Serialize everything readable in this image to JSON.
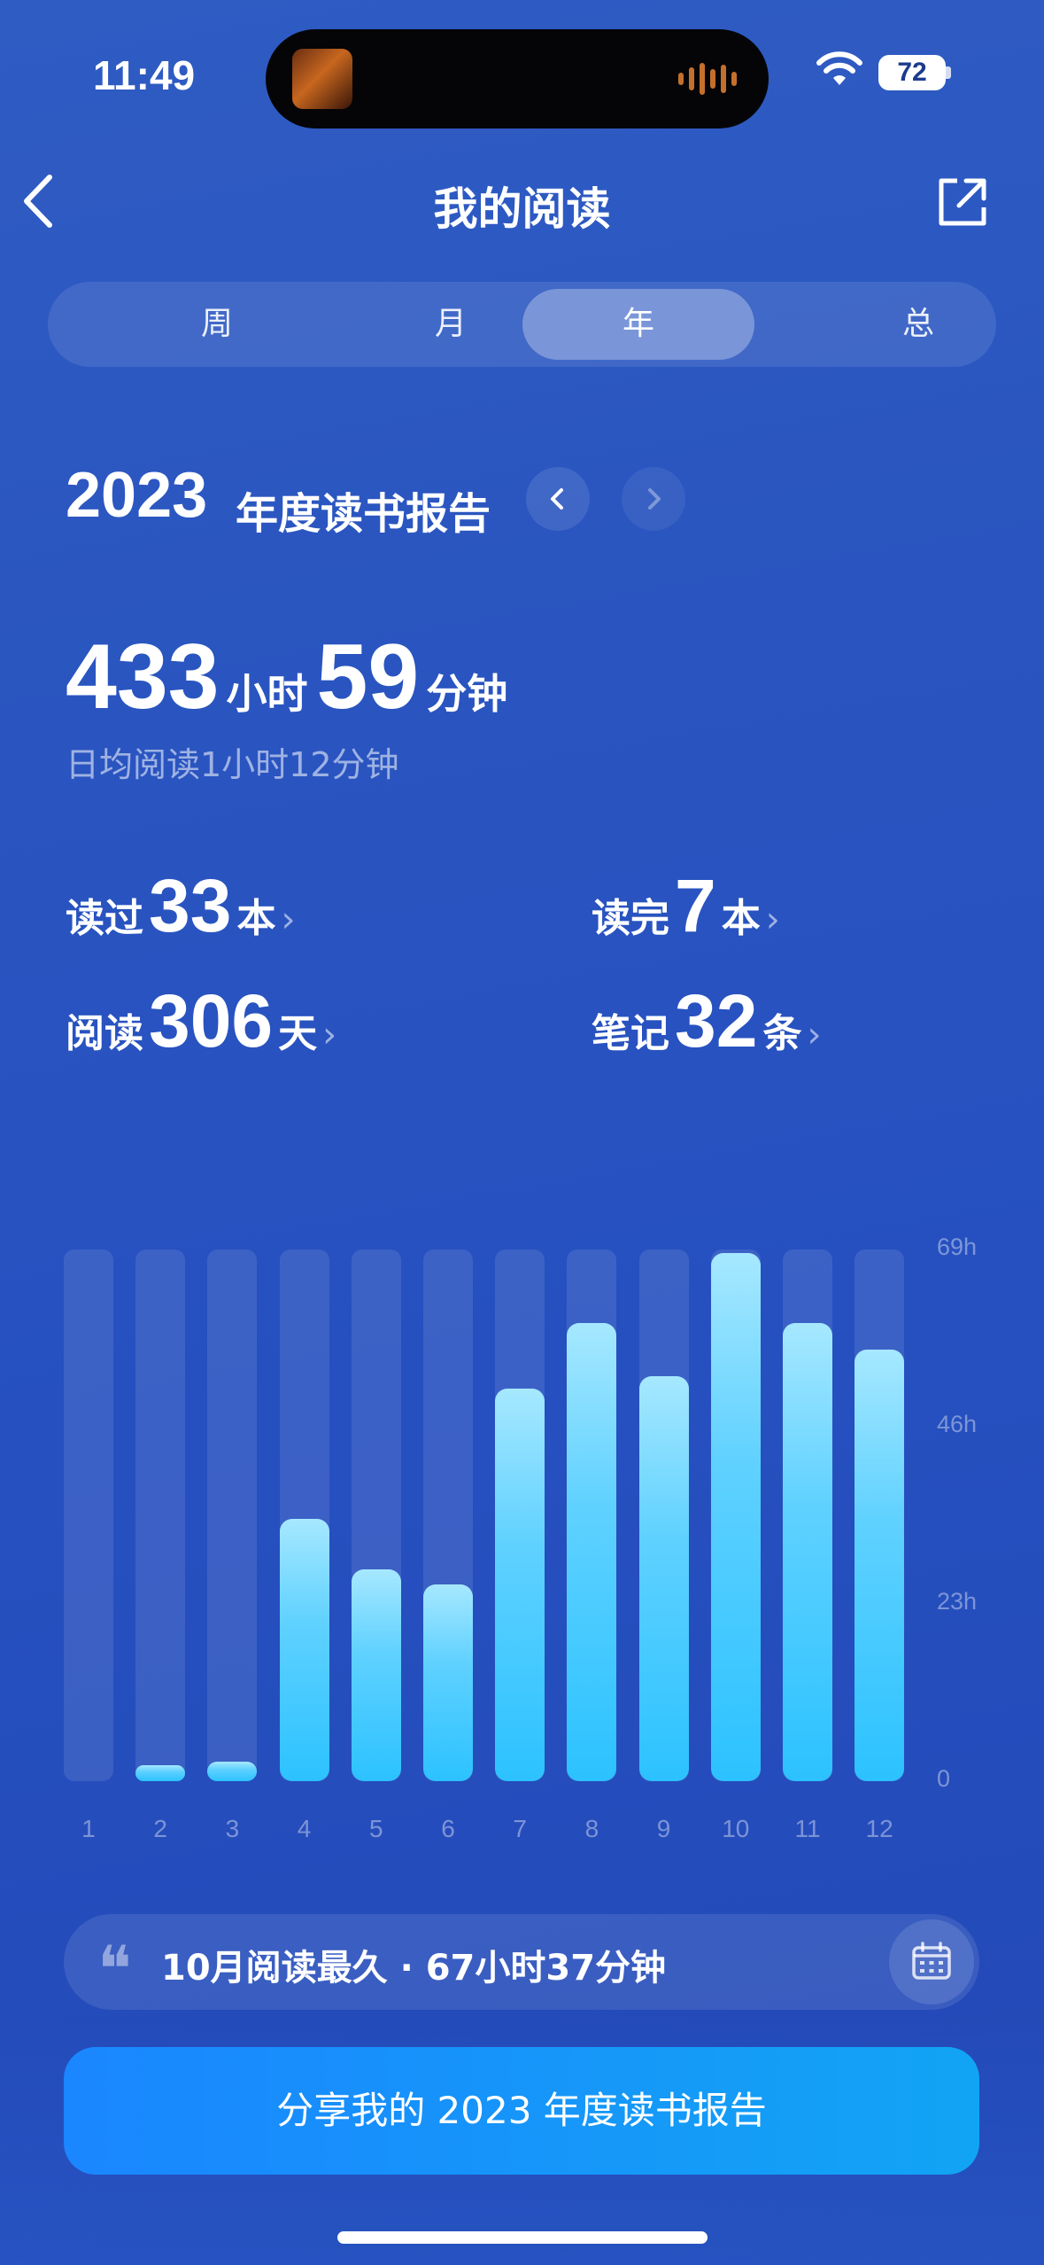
{
  "status_bar": {
    "time": "11:49",
    "battery": "72"
  },
  "nav": {
    "title": "我的阅读"
  },
  "tabs": [
    {
      "label": "周",
      "active": false
    },
    {
      "label": "月",
      "active": false
    },
    {
      "label": "年",
      "active": true
    },
    {
      "label": "总",
      "active": false
    }
  ],
  "report": {
    "year": "2023",
    "label": "年度读书报告"
  },
  "totals": {
    "hours": "433",
    "hours_unit": "小时",
    "minutes": "59",
    "minutes_unit": "分钟",
    "daily": "日均阅读1小时12分钟"
  },
  "stats": {
    "read": {
      "label": "读过",
      "value": "33",
      "unit": "本"
    },
    "finished": {
      "label": "读完",
      "value": "7",
      "unit": "本"
    },
    "days": {
      "label": "阅读",
      "value": "306",
      "unit": "天"
    },
    "notes": {
      "label": "笔记",
      "value": "32",
      "unit": "条"
    }
  },
  "chart_data": {
    "type": "bar",
    "categories": [
      "1",
      "2",
      "3",
      "4",
      "5",
      "6",
      "7",
      "8",
      "9",
      "10",
      "11",
      "12"
    ],
    "values": [
      0,
      2,
      2.5,
      34,
      27.5,
      25.5,
      51,
      59.5,
      52.5,
      68.5,
      59.5,
      56
    ],
    "y_ticks": [
      "69h",
      "46h",
      "23h",
      "0"
    ],
    "y_tick_values": [
      69,
      46,
      23,
      0
    ],
    "ylim": [
      0,
      69
    ],
    "grid": false,
    "colors": {
      "bar": "#2cc2ff",
      "bar_top": "#a6e8ff",
      "track": "rgba(255,255,255,0.1)"
    }
  },
  "summary": {
    "text": "10月阅读最久 · 67小时37分钟"
  },
  "share_button": {
    "label": "分享我的 2023 年度读书报告"
  },
  "icons": [
    "back-chevron-icon",
    "share-out-icon",
    "prev-icon",
    "next-icon",
    "quote-icon",
    "calendar-icon",
    "wifi-icon"
  ]
}
